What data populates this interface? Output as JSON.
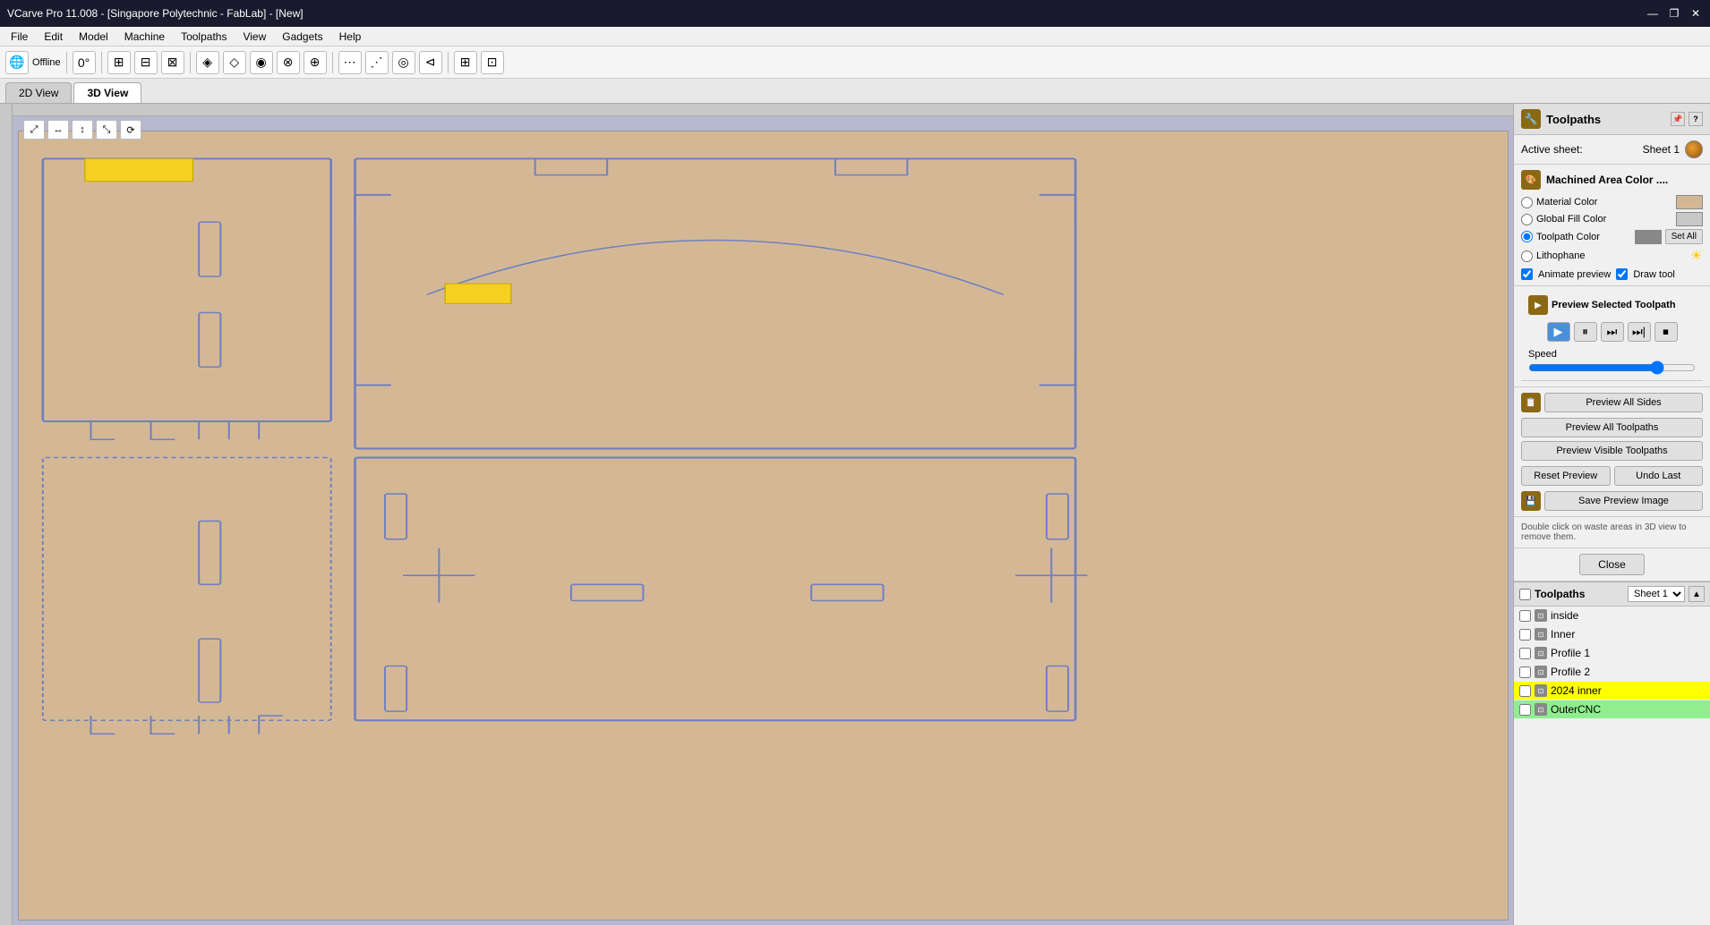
{
  "titlebar": {
    "title": "VCarve Pro 11.008 - [Singapore Polytechnic - FabLab] - [New]",
    "minimize": "—",
    "restore": "❐",
    "close": "✕"
  },
  "menubar": {
    "items": [
      "File",
      "Edit",
      "Model",
      "Machine",
      "Toolpaths",
      "View",
      "Gadgets",
      "Help"
    ]
  },
  "viewtabs": {
    "tabs": [
      "2D View",
      "3D View"
    ],
    "active": "3D View"
  },
  "toolbar": {
    "online_label": "Offline",
    "zoom_label": "0°"
  },
  "right_panel": {
    "title": "Toolpaths",
    "icon_symbol": "🔧",
    "active_sheet_label": "Active sheet:",
    "sheet_name": "Sheet 1",
    "machined_area_label": "Machined Area Color ....",
    "material_color_label": "Material Color",
    "global_fill_label": "Global Fill Color",
    "toolpath_color_label": "Toolpath Color",
    "lithophane_label": "Lithophane",
    "set_all_label": "Set All",
    "animate_preview_label": "Animate preview",
    "draw_tool_label": "Draw tool",
    "preview_selected_label": "Preview Selected Toolpath",
    "speed_label": "Speed",
    "preview_all_sides_label": "Preview All Sides",
    "preview_all_toolpaths_label": "Preview All Toolpaths",
    "preview_visible_toolpaths_label": "Preview Visible Toolpaths",
    "reset_preview_label": "Reset Preview",
    "undo_last_label": "Undo Last",
    "save_preview_image_label": "Save Preview Image",
    "dblclick_note": "Double click on waste areas in 3D view to remove them.",
    "close_label": "Close"
  },
  "toolpaths_list": {
    "header_label": "Toolpaths",
    "sheet_label": "Sheet 1",
    "items": [
      {
        "name": "inside",
        "checked": false,
        "highlighted": false,
        "color": "#888888"
      },
      {
        "name": "Inner",
        "checked": false,
        "highlighted": false,
        "color": "#888888"
      },
      {
        "name": "Profile 1",
        "checked": false,
        "highlighted": false,
        "color": "#888888"
      },
      {
        "name": "Profile 2",
        "checked": false,
        "highlighted": false,
        "color": "#888888"
      },
      {
        "name": "2024 inner",
        "checked": false,
        "highlighted": true,
        "highlight_color": "#ffff00"
      },
      {
        "name": "OuterCNC",
        "checked": false,
        "highlighted": true,
        "highlight_color": "#90ee90"
      }
    ]
  },
  "canvas": {
    "background_color": "#b8b8d0",
    "wood_color": "#d4b896"
  }
}
